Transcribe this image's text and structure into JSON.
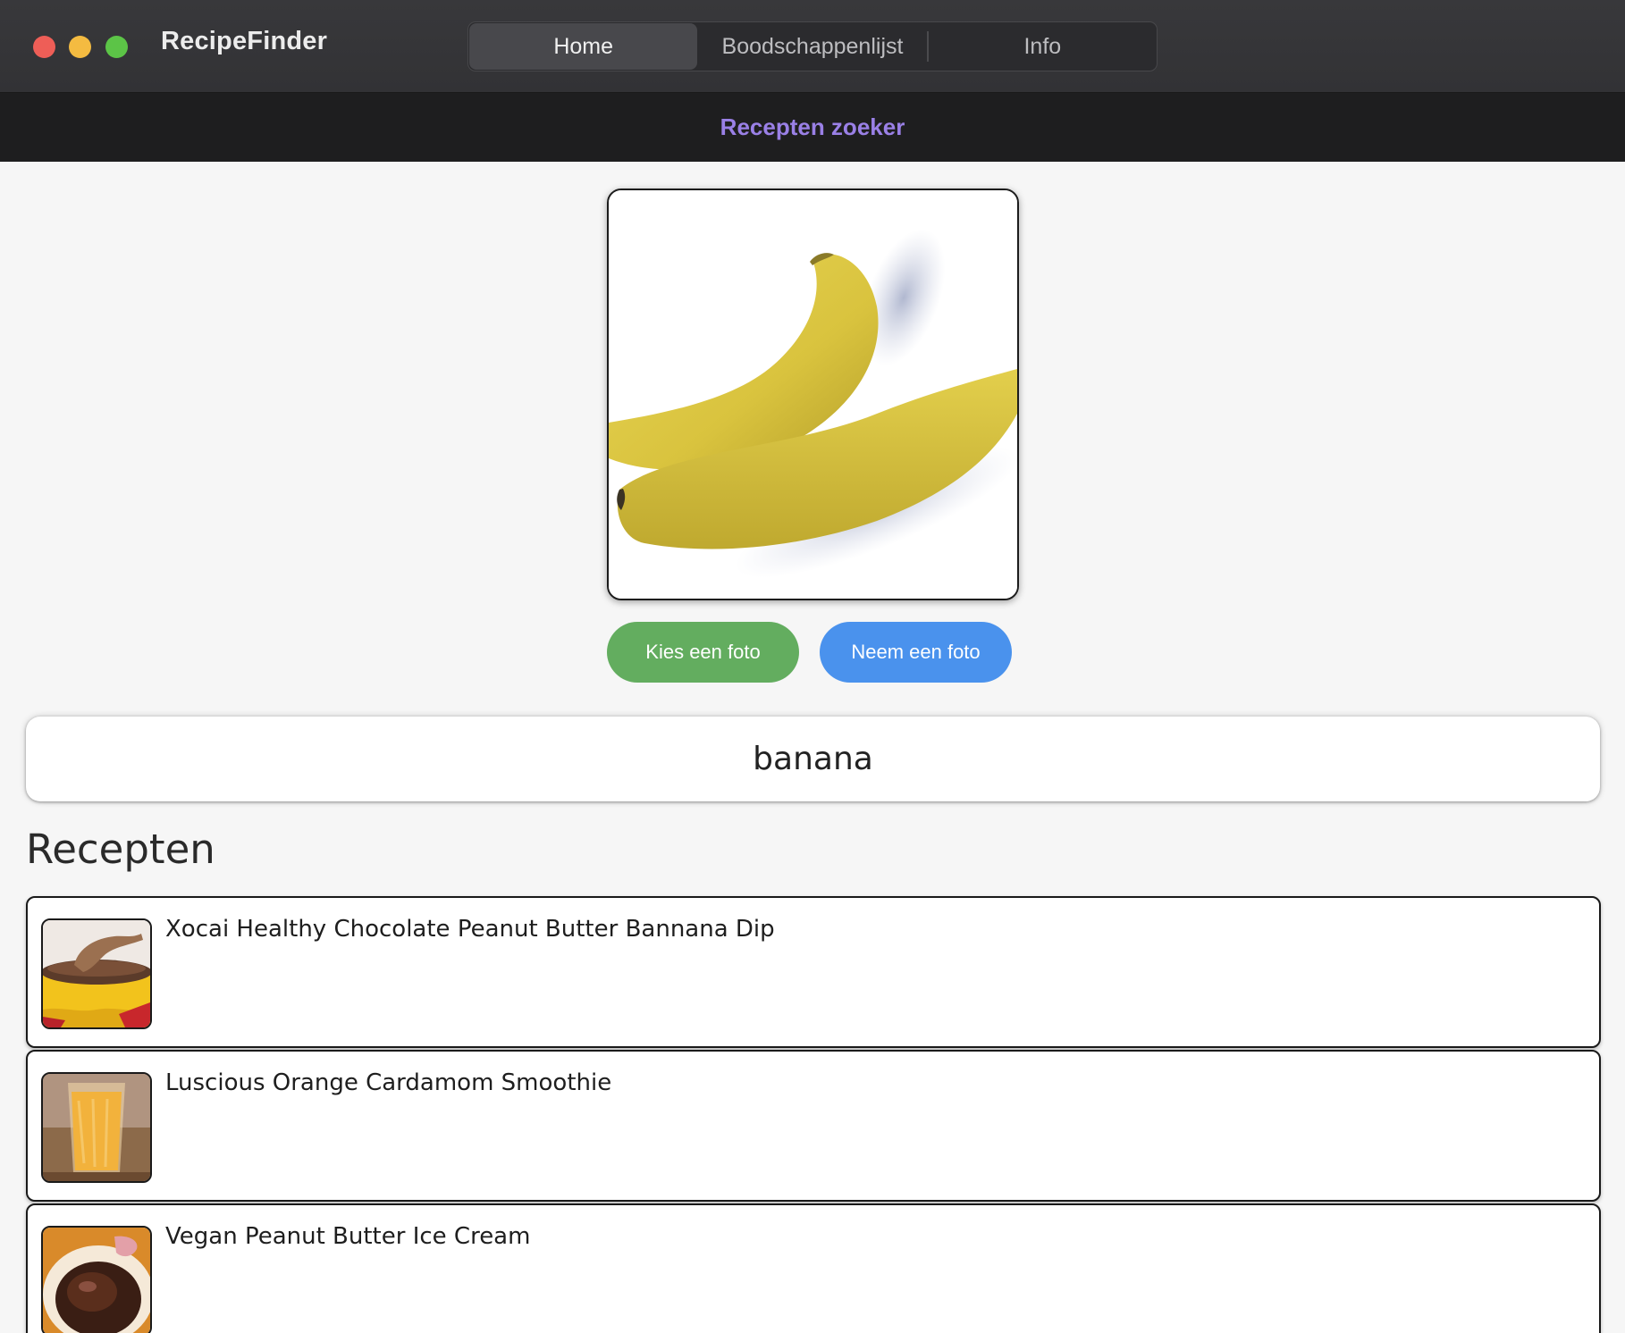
{
  "window": {
    "app_title": "RecipeFinder"
  },
  "tabs": [
    {
      "label": "Home",
      "active": true
    },
    {
      "label": "Boodschappenlijst",
      "active": false
    },
    {
      "label": "Info",
      "active": false
    }
  ],
  "navbar": {
    "title": "Recepten zoeker"
  },
  "photo": {
    "subject": "banana"
  },
  "buttons": {
    "choose_photo": "Kies een foto",
    "take_photo": "Neem een foto"
  },
  "search": {
    "value": "banana"
  },
  "recipes_section": {
    "title": "Recepten",
    "items": [
      {
        "name": "Xocai Healthy Chocolate Peanut Butter Bannana Dip",
        "thumb": "chocolate-dip"
      },
      {
        "name": "Luscious Orange Cardamom Smoothie",
        "thumb": "orange-smoothie"
      },
      {
        "name": "Vegan Peanut Butter Ice Cream",
        "thumb": "ice-cream"
      }
    ]
  },
  "colors": {
    "accent_purple": "#9a80e6",
    "choose_button": "#63ad5f",
    "take_button": "#4a92ed",
    "traffic_close": "#ee5e57",
    "traffic_min": "#f4bb41",
    "traffic_max": "#5cc447"
  }
}
